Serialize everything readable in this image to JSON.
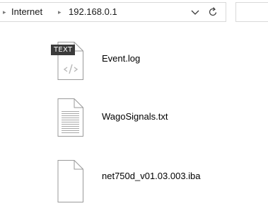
{
  "address_bar": {
    "crumbs": [
      "Internet",
      "192.168.0.1"
    ],
    "history_icon": "chevron-down-icon",
    "refresh_icon": "refresh-icon"
  },
  "files": [
    {
      "name": "Event.log",
      "icon": "log-file-icon",
      "badge": "TEXT"
    },
    {
      "name": "WagoSignals.txt",
      "icon": "text-file-icon"
    },
    {
      "name": "net750d_v01.03.003.iba",
      "icon": "generic-file-icon"
    }
  ]
}
